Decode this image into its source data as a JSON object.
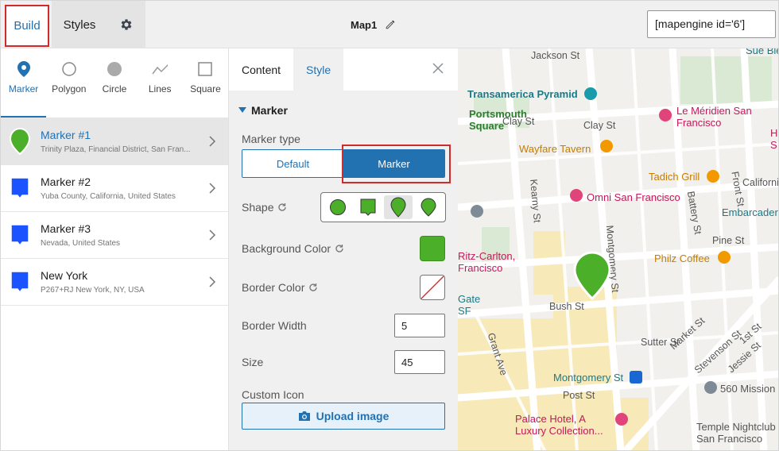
{
  "topbar": {
    "build_tab": "Build",
    "styles_tab": "Styles",
    "map_title": "Map1",
    "shortcode": "[mapengine id='6']"
  },
  "shape_types": [
    {
      "label": "Marker"
    },
    {
      "label": "Polygon"
    },
    {
      "label": "Circle"
    },
    {
      "label": "Lines"
    },
    {
      "label": "Square"
    }
  ],
  "markers": [
    {
      "name": "Marker #1",
      "address": "Trinity Plaza, Financial District, San Fran...",
      "color": "#4caf2a",
      "shape": "pin"
    },
    {
      "name": "Marker #2",
      "address": "Yuba County, California, United States",
      "color": "#1a53ff",
      "shape": "square"
    },
    {
      "name": "Marker #3",
      "address": "Nevada, United States",
      "color": "#1a53ff",
      "shape": "square"
    },
    {
      "name": "New York",
      "address": "P267+RJ New York, NY, USA",
      "color": "#1a53ff",
      "shape": "square"
    }
  ],
  "panel": {
    "tab_content": "Content",
    "tab_style": "Style",
    "section_title": "Marker",
    "marker_type_label": "Marker type",
    "marker_type_default": "Default",
    "marker_type_marker": "Marker",
    "shape_label": "Shape",
    "bg_color_label": "Background Color",
    "bg_color": "#4caf2a",
    "border_color_label": "Border Color",
    "border_width_label": "Border Width",
    "border_width": "5",
    "size_label": "Size",
    "size": "45",
    "custom_icon_label": "Custom Icon",
    "upload_button": "Upload image"
  },
  "map": {
    "streets": [
      "Jackson St",
      "Clay St",
      "Clay St",
      "Kearny St",
      "Pine St",
      "Bush St",
      "Sutter St",
      "Post St",
      "Grant Ave",
      "Montgomery St",
      "Battery St",
      "Front St",
      "California",
      "Market St",
      "Stevenson St",
      "Jessie St",
      "1st St"
    ],
    "places": [
      "Transamerica Pyramid",
      "Portsmouth Square",
      "Le Méridien San Francisco",
      "Wayfare Tavern",
      "Tadich Grill",
      "Omni San Francisco",
      "Embarcader",
      "Ritz-Carlton, Francisco",
      "Philz Coffee",
      "Gate SF",
      "Montgomery St",
      "560 Mission",
      "Palace Hotel, A Luxury Collection...",
      "Temple Nightclub San Francisco",
      "Sue Bie",
      "H S"
    ]
  }
}
